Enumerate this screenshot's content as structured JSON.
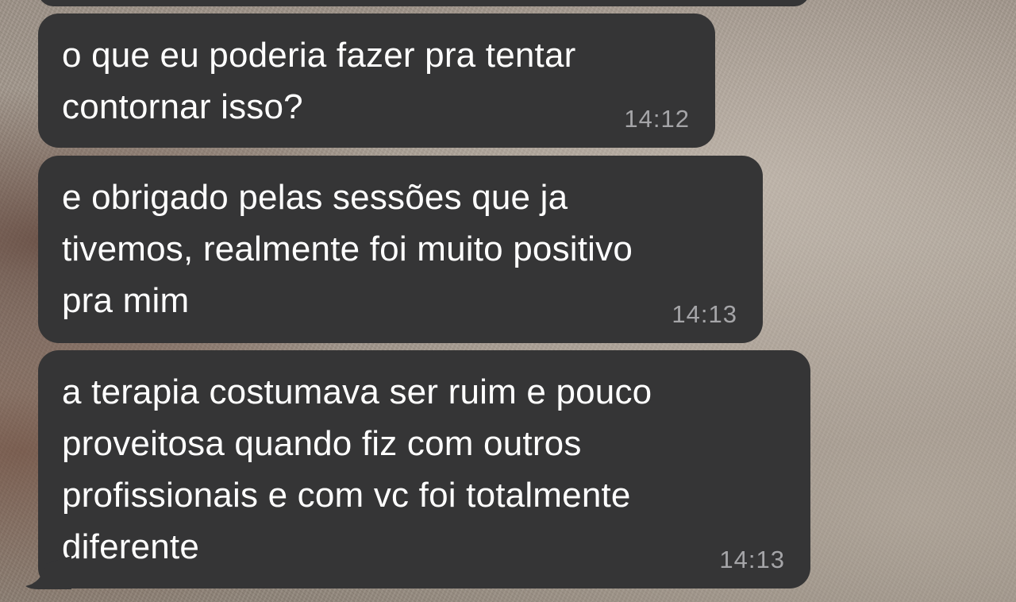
{
  "messages": [
    {
      "text": "o que eu poderia fazer pra tentar\ncontornar isso?",
      "time": "14:12"
    },
    {
      "text": "e obrigado pelas sessões que ja\ntivemos, realmente foi muito positivo\npra mim",
      "time": "14:13"
    },
    {
      "text": "a terapia costumava ser ruim e pouco\nproveitosa quando fiz com outros\nprofissionais e com vc foi totalmente\ndiferente",
      "time": "14:13"
    }
  ],
  "colors": {
    "bubble": "#353536",
    "text": "#ffffff",
    "time": "#a5a5a8"
  }
}
